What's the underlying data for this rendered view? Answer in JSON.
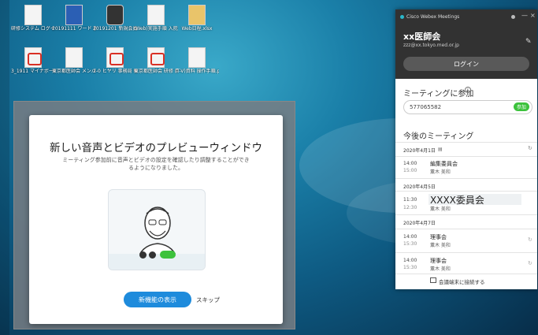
{
  "desktop": {
    "icons": [
      {
        "label": "研修システム ログイン情報.txt",
        "icon": "text-file-icon"
      },
      {
        "label": "20191111 ワード 参加簿(記入).docx",
        "icon": "word-doc-icon"
      },
      {
        "label": "20191201 新規会員 登録データ",
        "icon": "gear-app-icon"
      },
      {
        "label": "(Web)実施手順 入院中実施",
        "icon": "text-file-icon"
      },
      {
        "label": "Web日程.xlsx",
        "icon": "folder-icon"
      },
      {
        "label": "3_1911 マイナポータル を活用した",
        "icon": "pdf-icon"
      },
      {
        "label": "東京都医師会 メンバーズ",
        "icon": "file-icon"
      },
      {
        "label": "2-0 ヒヤリ 事務局 報告",
        "icon": "pdf-icon"
      },
      {
        "label": "東京都医師会 研修 用(入)ガイド",
        "icon": "pdf-icon"
      },
      {
        "label": "(T-V)資料 操作手順.pptx",
        "icon": "pptx-icon"
      }
    ]
  },
  "dialog": {
    "title": "新しい音声とビデオのプレビューウィンドウ",
    "description": "ミーティング参加前に音声とビデオの設定を確認したり調整することができるようになりました。",
    "primary_button": "新機能の表示",
    "skip": "スキップ"
  },
  "webex": {
    "app_title": "Cisco Webex Meetings",
    "user_name": "xx医師会",
    "email": "zzz@xx.tokyo.med.or.jp",
    "login": "ログイン",
    "join_heading": "ミーティングに参加",
    "meeting_number": "577065582",
    "join_button": "参加",
    "upcoming_heading": "今後のミーティング",
    "connect_device": "会議端末に接続する",
    "days": [
      {
        "date": "2020年4月1日",
        "meetings": [
          {
            "start": "14:00",
            "end": "15:00",
            "name": "編集委員会",
            "host": "薫木 美和"
          }
        ]
      },
      {
        "date": "2020年4月5日",
        "meetings": [
          {
            "start": "11:30",
            "end": "12:30",
            "name": "XXXX委員会",
            "host": "薫木 美和"
          }
        ]
      },
      {
        "date": "2020年4月7日",
        "meetings": [
          {
            "start": "14:00",
            "end": "15:30",
            "name": "理事会",
            "host": "薫木 美和"
          },
          {
            "start": "14:00",
            "end": "15:30",
            "name": "理事会",
            "host": "薫木 美和"
          }
        ]
      }
    ]
  }
}
